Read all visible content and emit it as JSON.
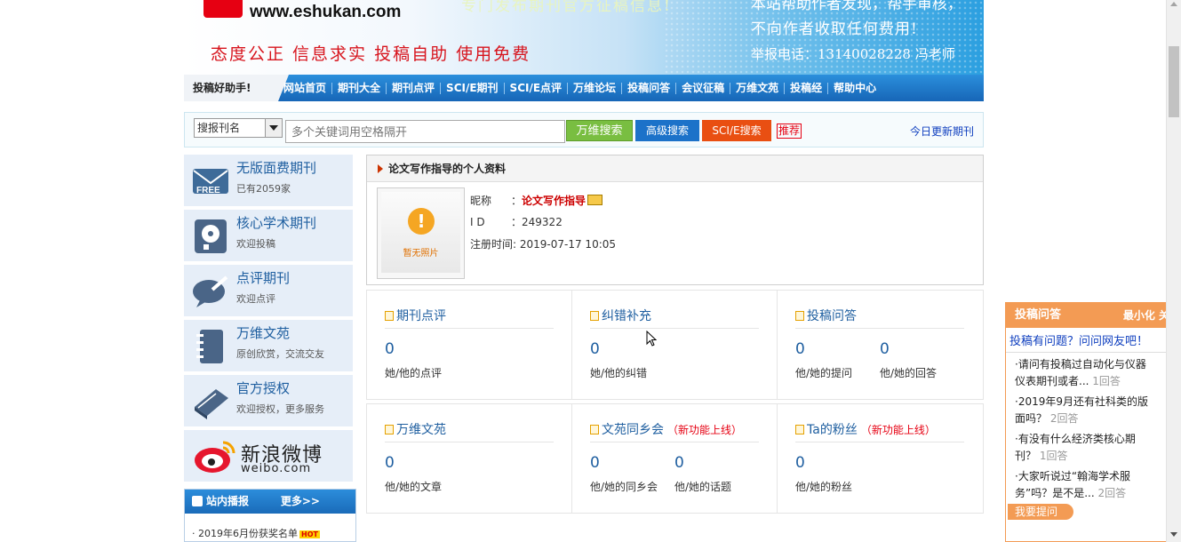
{
  "banner": {
    "site_url": "www.eshukan.com",
    "slogan": "态度公正  信息求实  投稿自助  使用免费",
    "tagline_partial": "专门发布期刊官方征稿信息!",
    "note_top_partial": "本站帮助作者发现，帮手审核，",
    "note_mid": "不向作者收取任何费用!",
    "report_phone": "举报电话：13140028228 冯老师"
  },
  "nav": {
    "helper": "投稿好助手!",
    "links": [
      "网站首页",
      "期刊大全",
      "期刊点评",
      "SCI/E期刊",
      "SCI/E点评",
      "万维论坛",
      "投稿问答",
      "会议征稿",
      "万维文苑",
      "投稿经",
      "帮助中心"
    ]
  },
  "search": {
    "select_value": "搜报刊名",
    "placeholder": "多个关键词用空格隔开",
    "btn_wanwei": "万维搜索",
    "btn_advanced": "高级搜索",
    "btn_scie": "SCI/E搜索",
    "recommend": "推荐",
    "today_update": "今日更新期刊"
  },
  "sidebar": {
    "items": [
      {
        "title": "无版面费期刊",
        "sub": "已有2059家",
        "icon": "free-mail-icon"
      },
      {
        "title": "核心学术期刊",
        "sub": "欢迎投稿",
        "icon": "disk-icon"
      },
      {
        "title": "点评期刊",
        "sub": "欢迎点评",
        "icon": "comment-pen-icon"
      },
      {
        "title": "万维文苑",
        "sub": "原创欣赏，交流交友",
        "icon": "notebook-icon"
      },
      {
        "title": "官方授权",
        "sub": "欢迎授权，更多服务",
        "icon": "book-icon"
      }
    ],
    "weibo": {
      "name": "新浪微博",
      "sub": "weibo.com"
    },
    "brief": {
      "title": "站内播报",
      "more": "更多>>",
      "item": "· 2019年6月份获奖名单",
      "hot": "HOT"
    }
  },
  "profile": {
    "header": "论文写作指导的个人资料",
    "no_photo": "暂无照片",
    "nickname_label": "昵称",
    "nickname": "论文写作指导",
    "id_label": "I D",
    "id": "249322",
    "reg_label": "注册时间:",
    "reg_time": "2019-07-17 10:05"
  },
  "stats_row1": [
    {
      "title": "期刊点评",
      "values": [
        {
          "num": "0",
          "label": "她/他的点评"
        }
      ]
    },
    {
      "title": "纠错补充",
      "values": [
        {
          "num": "0",
          "label": "她/他的纠错"
        }
      ]
    },
    {
      "title": "投稿问答",
      "values": [
        {
          "num": "0",
          "label": "他/她的提问"
        },
        {
          "num": "0",
          "label": "他/她的回答"
        }
      ]
    }
  ],
  "stats_row2": [
    {
      "title": "万维文苑",
      "newtag": "",
      "values": [
        {
          "num": "0",
          "label": "他/她的文章"
        }
      ]
    },
    {
      "title": "文苑同乡会",
      "newtag": "（新功能上线）",
      "values": [
        {
          "num": "0",
          "label": "他/她的同乡会"
        },
        {
          "num": "0",
          "label": "他/她的话题"
        }
      ]
    },
    {
      "title": "Ta的粉丝",
      "newtag": "（新功能上线）",
      "values": [
        {
          "num": "0",
          "label": "他/她的粉丝"
        }
      ]
    }
  ],
  "ask_widget": {
    "title": "投稿问答",
    "minimize": "最小化  关",
    "question": "投稿有问题？问问网友吧！",
    "items": [
      {
        "text": "·请问有投稿过自动化与仪器仪表期刊或者...",
        "count": "1回答"
      },
      {
        "text": "·2019年9月还有社科类的版面吗？",
        "count": "2回答"
      },
      {
        "text": "·有没有什么经济类核心期刊？",
        "count": "1回答"
      },
      {
        "text": "·大家听说过“翰海学术服务”吗？是不是...",
        "count": "2回答"
      }
    ],
    "ask_button": "我要提问"
  },
  "colors": {
    "nav_blue": "#1a72c4",
    "accent_orange": "#f39b54",
    "link_blue": "#1f5fa0",
    "alert_red": "#e60012"
  }
}
